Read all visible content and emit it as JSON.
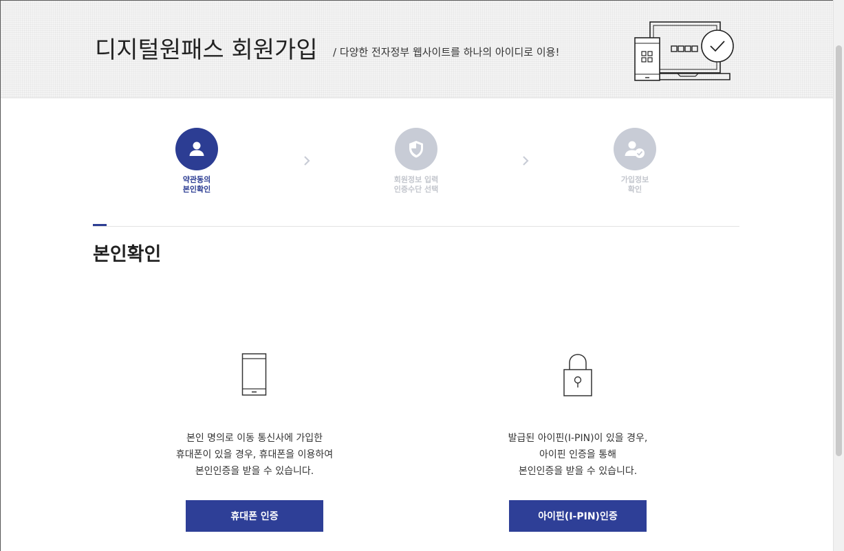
{
  "header": {
    "title": "디지털원패스 회원가입",
    "subtitle": "/ 다양한 전자정부 웹사이트를 하나의 아이디로 이용!"
  },
  "steps": [
    {
      "label": "약관동의\n본인확인",
      "state": "active",
      "icon": "user-icon"
    },
    {
      "label": "회원정보 입력\n인증수단 선택",
      "state": "inactive",
      "icon": "shield-icon"
    },
    {
      "label": "가입정보\n확인",
      "state": "inactive",
      "icon": "user-check-icon"
    }
  ],
  "section": {
    "title": "본인확인"
  },
  "auth_methods": [
    {
      "icon": "mobile-phone-icon",
      "description": "본인 명의로 이동 통신사에 가입한\n휴대폰이 있을 경우, 휴대폰을 이용하여\n본인인증을 받을 수 있습니다.",
      "button_label": "휴대폰 인증"
    },
    {
      "icon": "padlock-icon",
      "description": "발급된 아이핀(I-PIN)이 있을 경우,\n아이핀 인증을 통해\n본인인증을 받을 수 있습니다.",
      "button_label": "아이핀(I-PIN)인증"
    }
  ],
  "colors": {
    "accent": "#2c3d93",
    "button": "#2e3f97",
    "inactive_step": "#c8ccd6"
  }
}
